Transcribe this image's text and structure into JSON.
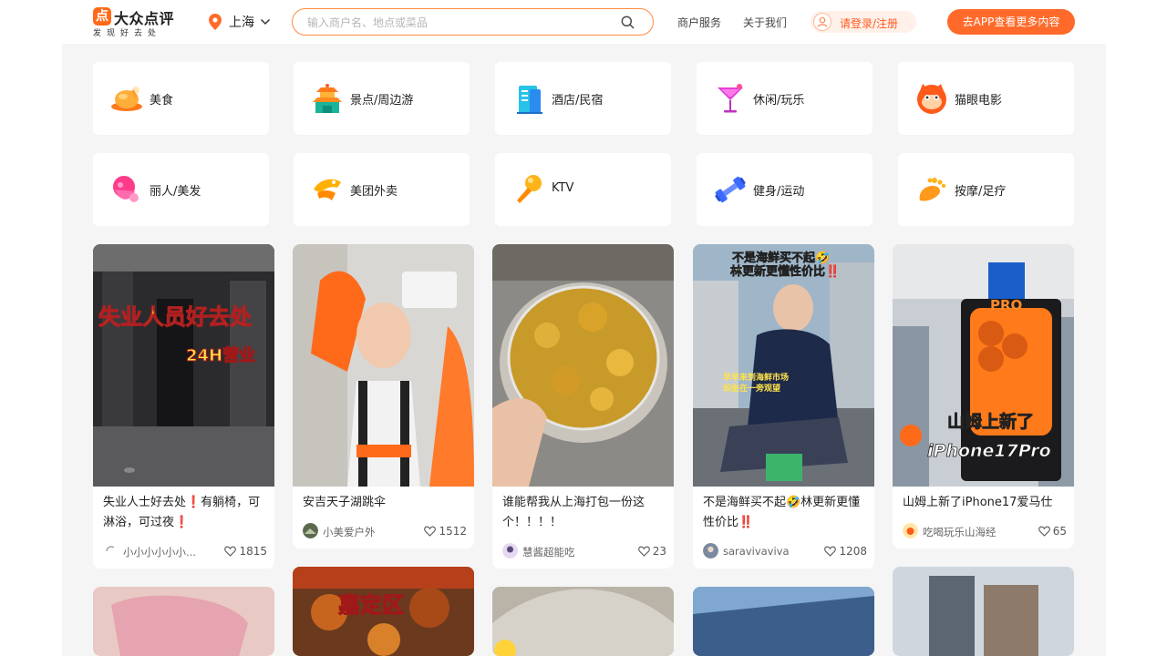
{
  "header": {
    "logo_mark": "点",
    "logo_title": "大众点评",
    "logo_sub": "发现好去处",
    "city": "上海",
    "search_placeholder": "输入商户名、地点或菜品",
    "nav": [
      "商户服务",
      "关于我们"
    ],
    "login": "请登录/注册",
    "app_button": "去APP查看更多内容"
  },
  "categories": [
    {
      "label": "美食",
      "icon": "roast-chicken-icon"
    },
    {
      "label": "景点/周边游",
      "icon": "pagoda-icon"
    },
    {
      "label": "酒店/民宿",
      "icon": "hotel-building-icon"
    },
    {
      "label": "休闲/玩乐",
      "icon": "cocktail-icon"
    },
    {
      "label": "猫眼电影",
      "icon": "cat-face-icon"
    },
    {
      "label": "丽人/美发",
      "icon": "beauty-head-icon"
    },
    {
      "label": "美团外卖",
      "icon": "delivery-kangaroo-icon"
    },
    {
      "label": "KTV",
      "icon": "microphone-icon"
    },
    {
      "label": "健身/运动",
      "icon": "dumbbell-icon"
    },
    {
      "label": "按摩/足疗",
      "icon": "foot-icon"
    }
  ],
  "colors": {
    "brand": "#ff6a1a",
    "accent_button": "#ff6a2a",
    "search_border": "#ff8b3d",
    "page_bg": "#f5f5f5"
  },
  "feed": [
    {
      "title": "失业人士好去处❗有躺椅，可淋浴，可过夜❗",
      "author": "小小小小小小...",
      "likes": "1815",
      "image_text": [
        "失业人员好去处",
        "24H营业"
      ]
    },
    {
      "title": "安吉天子湖跳伞",
      "author": "小美爱户外",
      "likes": "1512",
      "image_text": []
    },
    {
      "title": "谁能帮我从上海打包一份这个！！！！",
      "author": "慧酱超能吃",
      "likes": "23",
      "image_text": []
    },
    {
      "title": "不是海鲜买不起🤣林更新更懂性价比‼️",
      "author": "saravivaviva",
      "likes": "1208",
      "image_text": [
        "不是海鲜买不起🤣",
        "林更新更懂性价比‼️",
        "早早来到海鲜市场",
        "却坐在一旁观望"
      ]
    },
    {
      "title": "山姆上新了iPhone17爱马仕",
      "author": "吃喝玩乐山海经",
      "likes": "65",
      "image_text": [
        "PRO",
        "山姆上新了",
        "iPhone17Pro"
      ]
    }
  ],
  "feed_row2": [
    {
      "image_text": []
    },
    {
      "image_text": [
        "嘉定区"
      ]
    },
    {
      "image_text": []
    },
    {
      "image_text": []
    },
    {
      "image_text": []
    }
  ]
}
